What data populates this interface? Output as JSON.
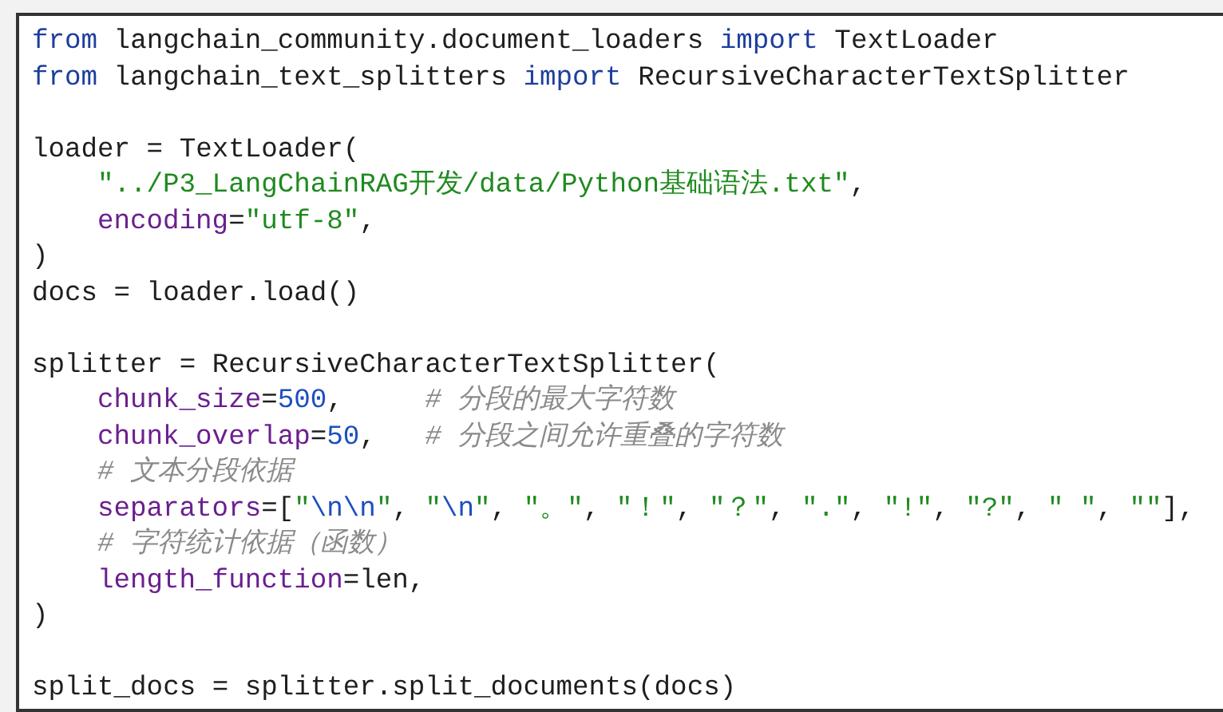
{
  "code_lines": [
    {
      "tokens": [
        {
          "kind": "keyword",
          "text": "from"
        },
        {
          "kind": "plain",
          "text": " langchain_community.document_loaders "
        },
        {
          "kind": "keyword",
          "text": "import"
        },
        {
          "kind": "plain",
          "text": " TextLoader"
        }
      ]
    },
    {
      "tokens": [
        {
          "kind": "keyword",
          "text": "from"
        },
        {
          "kind": "plain",
          "text": " langchain_text_splitters "
        },
        {
          "kind": "keyword",
          "text": "import"
        },
        {
          "kind": "plain",
          "text": " RecursiveCharacterTextSplitter"
        }
      ]
    },
    {
      "gap_before": true,
      "tokens": [
        {
          "kind": "plain",
          "text": "loader = TextLoader("
        }
      ]
    },
    {
      "indented": true,
      "tokens": [
        {
          "kind": "string",
          "text": "\"../P3_LangChainRAG开发/data/Python基础语法.txt\""
        },
        {
          "kind": "plain",
          "text": ","
        }
      ]
    },
    {
      "indented": true,
      "tokens": [
        {
          "kind": "param",
          "text": "encoding"
        },
        {
          "kind": "plain",
          "text": "="
        },
        {
          "kind": "string",
          "text": "\"utf-8\""
        },
        {
          "kind": "plain",
          "text": ","
        }
      ]
    },
    {
      "tokens": [
        {
          "kind": "plain",
          "text": ")"
        }
      ]
    },
    {
      "tokens": [
        {
          "kind": "plain",
          "text": "docs = loader.load()"
        }
      ]
    },
    {
      "gap_before": true,
      "tokens": [
        {
          "kind": "plain",
          "text": "splitter = RecursiveCharacterTextSplitter("
        }
      ]
    },
    {
      "indented": true,
      "tokens": [
        {
          "kind": "param",
          "text": "chunk_size"
        },
        {
          "kind": "plain",
          "text": "="
        },
        {
          "kind": "number",
          "text": "500"
        },
        {
          "kind": "plain",
          "text": ",     "
        },
        {
          "kind": "comment",
          "text": "# 分段的最大字符数"
        }
      ]
    },
    {
      "indented": true,
      "tokens": [
        {
          "kind": "param",
          "text": "chunk_overlap"
        },
        {
          "kind": "plain",
          "text": "="
        },
        {
          "kind": "number",
          "text": "50"
        },
        {
          "kind": "plain",
          "text": ",   "
        },
        {
          "kind": "comment",
          "text": "# 分段之间允许重叠的字符数"
        }
      ]
    },
    {
      "indented": true,
      "tokens": [
        {
          "kind": "comment",
          "text": "# 文本分段依据"
        }
      ]
    },
    {
      "indented": true,
      "tokens": [
        {
          "kind": "param",
          "text": "separators"
        },
        {
          "kind": "plain",
          "text": "=["
        },
        {
          "kind": "string",
          "text": "\""
        },
        {
          "kind": "escape",
          "text": "\\n\\n"
        },
        {
          "kind": "string",
          "text": "\""
        },
        {
          "kind": "plain",
          "text": ", "
        },
        {
          "kind": "string",
          "text": "\""
        },
        {
          "kind": "escape",
          "text": "\\n"
        },
        {
          "kind": "string",
          "text": "\""
        },
        {
          "kind": "plain",
          "text": ", "
        },
        {
          "kind": "string",
          "text": "\"。\""
        },
        {
          "kind": "plain",
          "text": ", "
        },
        {
          "kind": "string",
          "text": "\"！\""
        },
        {
          "kind": "plain",
          "text": ", "
        },
        {
          "kind": "string",
          "text": "\"？\""
        },
        {
          "kind": "plain",
          "text": ", "
        },
        {
          "kind": "string",
          "text": "\".\""
        },
        {
          "kind": "plain",
          "text": ", "
        },
        {
          "kind": "string",
          "text": "\"!\""
        },
        {
          "kind": "plain",
          "text": ", "
        },
        {
          "kind": "string",
          "text": "\"?\""
        },
        {
          "kind": "plain",
          "text": ", "
        },
        {
          "kind": "string",
          "text": "\" \""
        },
        {
          "kind": "plain",
          "text": ", "
        },
        {
          "kind": "string",
          "text": "\"\""
        },
        {
          "kind": "plain",
          "text": "],"
        }
      ]
    },
    {
      "indented": true,
      "tokens": [
        {
          "kind": "comment",
          "text": "# 字符统计依据（函数）"
        }
      ]
    },
    {
      "indented": true,
      "tokens": [
        {
          "kind": "param",
          "text": "length_function"
        },
        {
          "kind": "plain",
          "text": "=len,"
        }
      ]
    },
    {
      "tokens": [
        {
          "kind": "plain",
          "text": ")"
        }
      ]
    },
    {
      "gap_before": true,
      "tokens": [
        {
          "kind": "plain",
          "text": "split_docs = splitter.split_documents(docs)"
        }
      ]
    }
  ]
}
